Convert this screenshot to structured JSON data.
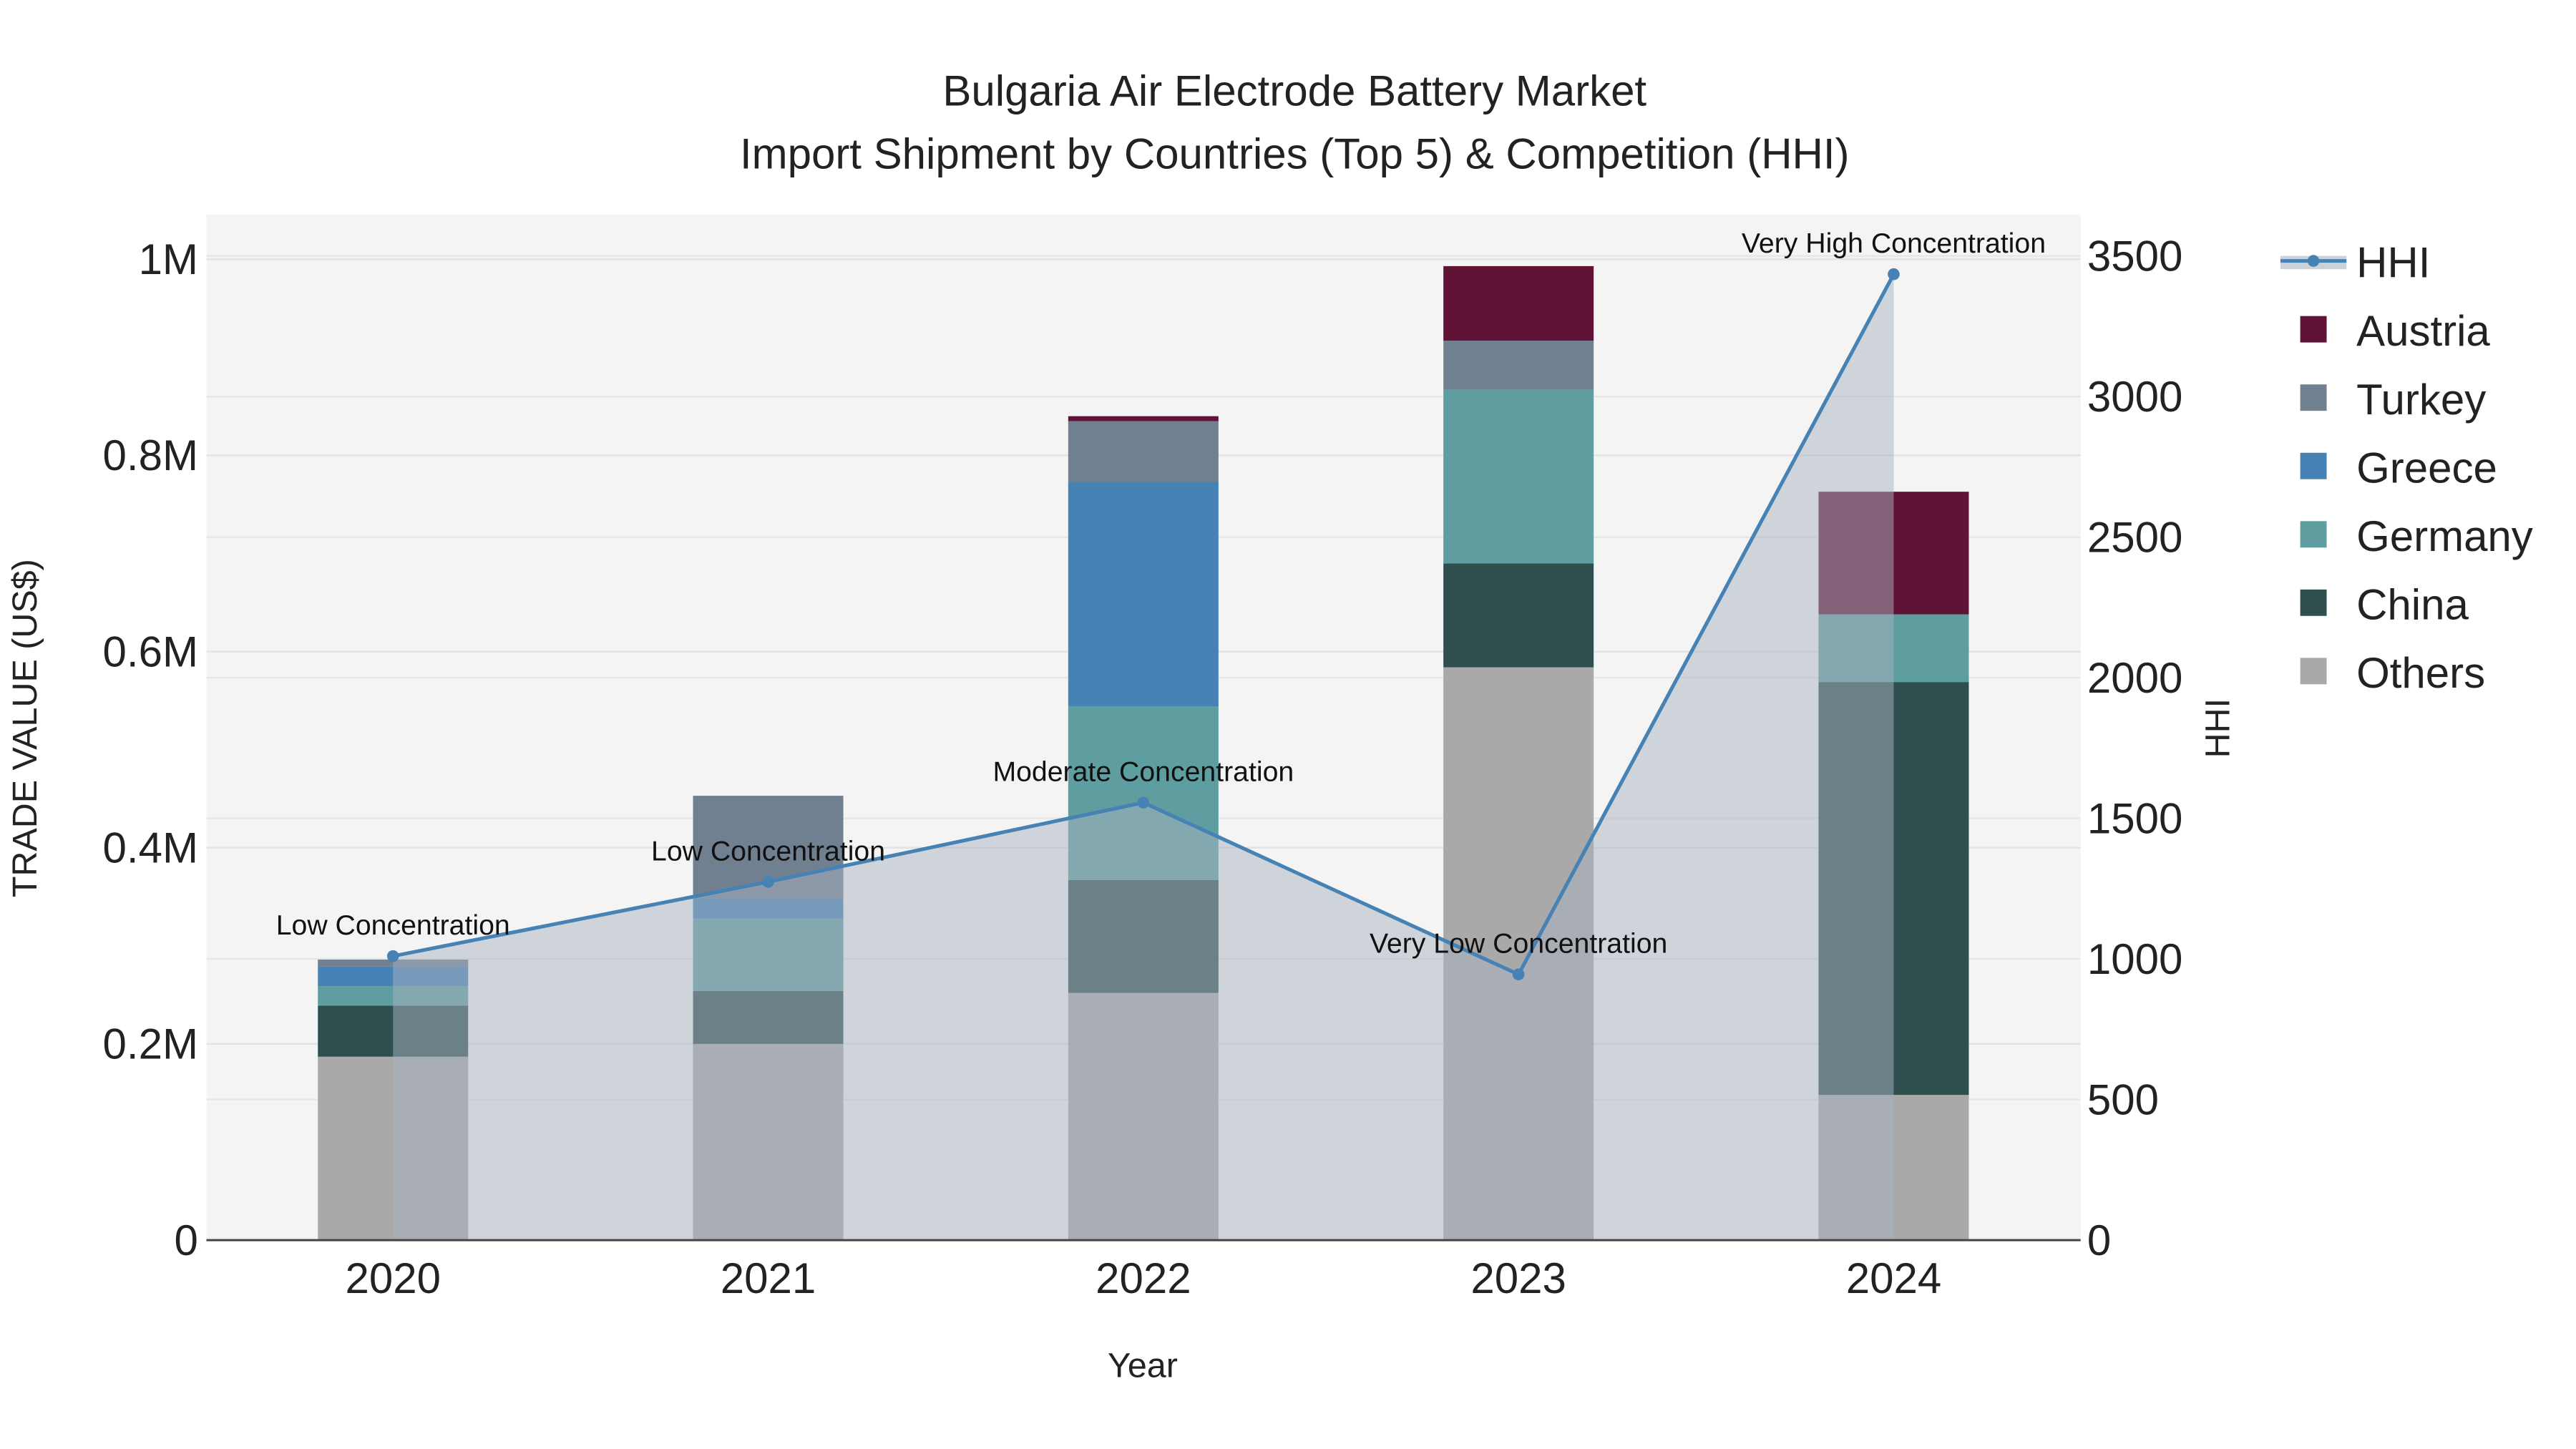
{
  "chart_data": {
    "type": "bar",
    "title": "Bulgaria Air Electrode Battery Market",
    "subtitle": "Import Shipment by Countries (Top 5) & Competition (HHI)",
    "xlabel": "Year",
    "ylabel": "TRADE VALUE (US$)",
    "y2label": "HHI",
    "categories": [
      "2020",
      "2021",
      "2022",
      "2023",
      "2024"
    ],
    "ylim": [
      0,
      1050000
    ],
    "y2lim": [
      0,
      3650
    ],
    "yticks": [
      {
        "v": 0,
        "label": "0"
      },
      {
        "v": 200000,
        "label": "0.2M"
      },
      {
        "v": 400000,
        "label": "0.4M"
      },
      {
        "v": 600000,
        "label": "0.6M"
      },
      {
        "v": 800000,
        "label": "0.8M"
      },
      {
        "v": 1000000,
        "label": "1M"
      }
    ],
    "y2ticks": [
      {
        "v": 0,
        "label": "0"
      },
      {
        "v": 500,
        "label": "500"
      },
      {
        "v": 1000,
        "label": "1000"
      },
      {
        "v": 1500,
        "label": "1500"
      },
      {
        "v": 2000,
        "label": "2000"
      },
      {
        "v": 2500,
        "label": "2500"
      },
      {
        "v": 3000,
        "label": "3000"
      },
      {
        "v": 3500,
        "label": "3500"
      }
    ],
    "series": [
      {
        "name": "Others",
        "color": "#a9a9a9",
        "values": [
          187000,
          200000,
          252000,
          584000,
          148000
        ]
      },
      {
        "name": "China",
        "color": "#2f4f4f",
        "values": [
          52000,
          54000,
          115000,
          106000,
          421000
        ]
      },
      {
        "name": "Germany",
        "color": "#5f9ea0",
        "values": [
          20000,
          74000,
          177000,
          177000,
          69000
        ]
      },
      {
        "name": "Greece",
        "color": "#4682b4",
        "values": [
          20000,
          20000,
          229000,
          0,
          0
        ]
      },
      {
        "name": "Turkey",
        "color": "#708090",
        "values": [
          7000,
          105000,
          62000,
          50000,
          0
        ]
      },
      {
        "name": "Austria",
        "color": "#5f1436",
        "values": [
          0,
          0,
          5000,
          76000,
          125000
        ]
      }
    ],
    "hhi": {
      "name": "HHI",
      "color": "#4682b4",
      "values": [
        1010,
        1274,
        1556,
        945,
        3435
      ],
      "annotations": [
        "Low Concentration",
        "Low Concentration",
        "Moderate Concentration",
        "Very Low Concentration",
        "Very High Concentration"
      ]
    },
    "legend": [
      "HHI",
      "Austria",
      "Turkey",
      "Greece",
      "Germany",
      "China",
      "Others"
    ],
    "legend_placement": "right",
    "grid": true
  }
}
